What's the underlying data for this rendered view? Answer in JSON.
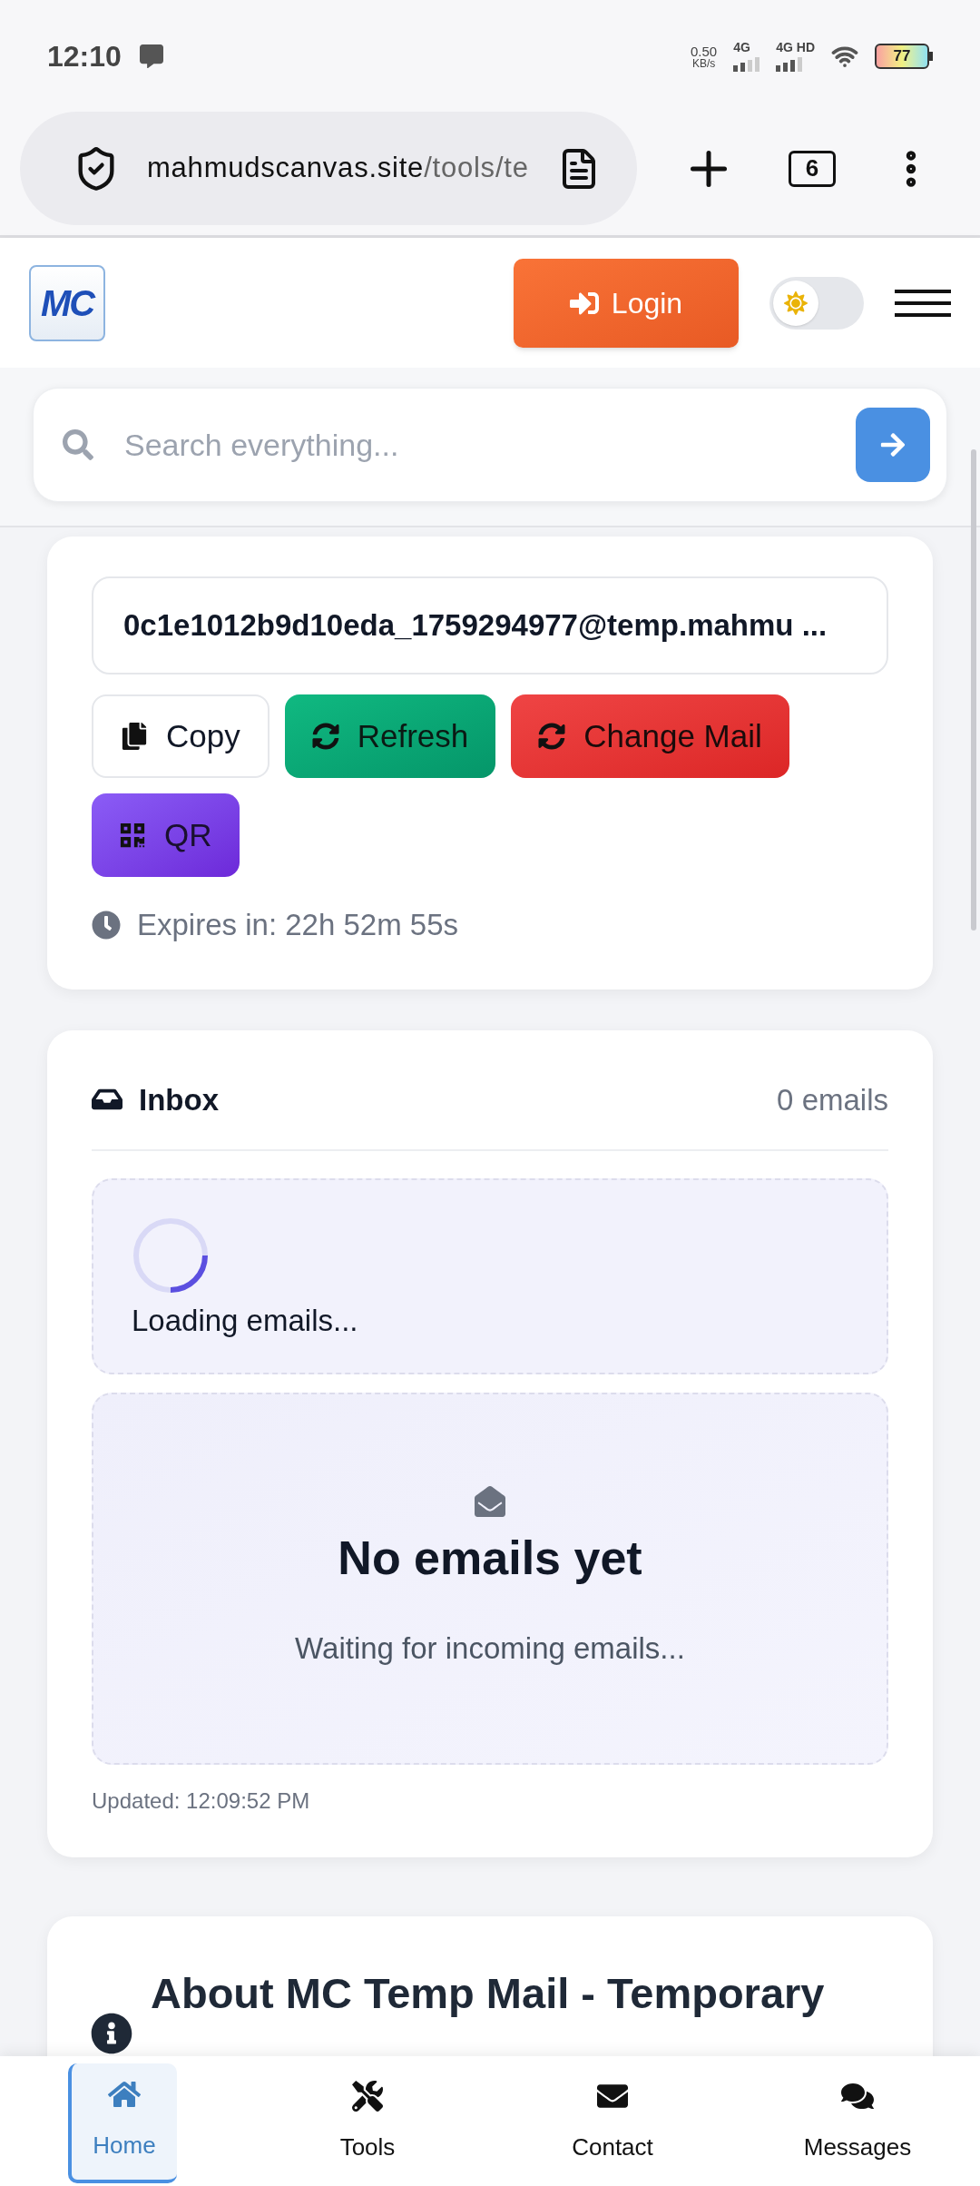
{
  "status_bar": {
    "time": "12:10",
    "net_speed": "0.50",
    "net_unit": "KB/s",
    "sim_1": "4G",
    "sim_2": "4G HD",
    "battery": "77"
  },
  "browser": {
    "url_host": "mahmudscanvas.site",
    "url_path": "/tools/te",
    "tab_count": "6"
  },
  "header": {
    "logo_text": "MC",
    "login": "Login",
    "dark_mode": false
  },
  "search": {
    "placeholder": "Search everything..."
  },
  "email_card": {
    "address": "0c1e1012b9d10eda_1759294977@temp.mahmu ...",
    "buttons": [
      {
        "kind": "copy",
        "label": "Copy"
      },
      {
        "kind": "refresh",
        "label": "Refresh"
      },
      {
        "kind": "change",
        "label": "Change Mail"
      },
      {
        "kind": "qr",
        "label": "QR"
      }
    ],
    "expires": "Expires in: 22h 52m 55s"
  },
  "inbox": {
    "title": "Inbox",
    "count": "0 emails",
    "loading": "Loading emails...",
    "empty_title": "No emails yet",
    "empty_text": "Waiting for incoming emails...",
    "updated": "Updated: 12:09:52 PM"
  },
  "about": {
    "title": "About MC Temp Mail - Temporary"
  },
  "bottom_nav": [
    {
      "kind": "home",
      "label": "Home",
      "selected": true
    },
    {
      "kind": "tools",
      "label": "Tools",
      "selected": false
    },
    {
      "kind": "contact",
      "label": "Contact",
      "selected": false
    },
    {
      "kind": "messages",
      "label": "Messages",
      "selected": false
    }
  ]
}
